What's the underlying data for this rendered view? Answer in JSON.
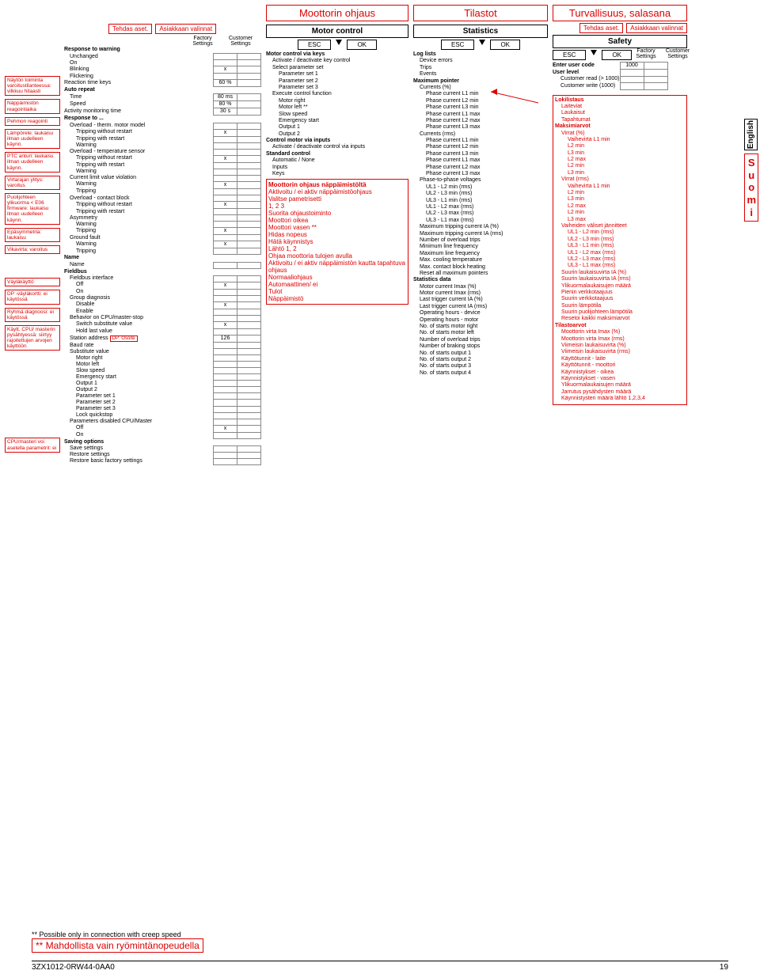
{
  "sidebar_callouts": [
    "Näytön toiminta varoitustilanteessa: vilkkuu hitaasti",
    "Näppäimistön reagointiaika",
    "Pehmon reagointi",
    "Lämpörele: laukaisu ilman uudelleen käynn.",
    "PTC anturi: laukaisu ilman uudelleen käynn.",
    "Virtarajan ylitys: varoitus",
    "Puolijohteen ylikuorma < E06 firmware: laukaisu ilman uudelleen käynn.",
    "Epäsymmetria: laukaisu",
    "Vikavirta: varoitus",
    "Väyläkäyttö",
    "DP -väyläkortti: ei käytössä",
    "Ryhmä diagnoosi: ei käytössä",
    "Käytt. CPU/ masterin pysähtyessä: siirtyy rajoitettujen arvojen käyttöön",
    "CPU/masteri voi asetella parametrit: ei"
  ],
  "settings": {
    "tag_factory": "Tehdas aset.",
    "tag_customer": "Asiakkaan valinnat",
    "col1": "Factory Settings",
    "col2": "Customer Settings",
    "rows": [
      [
        "Response to warning",
        "",
        "",
        0,
        true
      ],
      [
        "Unchanged",
        "",
        "",
        1,
        false
      ],
      [
        "On",
        "",
        "",
        1,
        false
      ],
      [
        "Blinking",
        "x",
        "",
        1,
        false
      ],
      [
        "Flickering",
        "",
        "",
        1,
        false
      ],
      [
        "Reaction time keys",
        "60 %",
        "",
        0,
        false
      ],
      [
        "Auto repeat",
        "",
        "",
        0,
        true
      ],
      [
        "Time",
        "80 ms",
        "",
        1,
        false
      ],
      [
        "Speed",
        "80 %",
        "",
        1,
        false
      ],
      [
        "Activity monitoring time",
        "30 s",
        "",
        0,
        false
      ],
      [
        "Response to ...",
        "",
        "",
        0,
        true
      ],
      [
        "Overload - therm. motor model",
        "",
        "",
        1,
        false
      ],
      [
        "Tripping without restart",
        "x",
        "",
        2,
        false
      ],
      [
        "Tripping with restart",
        "",
        "",
        2,
        false
      ],
      [
        "Warning",
        "",
        "",
        2,
        false
      ],
      [
        "Overload - temperature sensor",
        "",
        "",
        1,
        false
      ],
      [
        "Tripping without restart",
        "x",
        "",
        2,
        false
      ],
      [
        "Tripping with restart",
        "",
        "",
        2,
        false
      ],
      [
        "Warning",
        "",
        "",
        2,
        false
      ],
      [
        "Current limit value violation",
        "",
        "",
        1,
        false
      ],
      [
        "Warning",
        "x",
        "",
        2,
        false
      ],
      [
        "Tripping",
        "",
        "",
        2,
        false
      ],
      [
        "Overload - contact block",
        "",
        "",
        1,
        false
      ],
      [
        "Tripping without restart",
        "x",
        "",
        2,
        false
      ],
      [
        "Tripping with restart",
        "",
        "",
        2,
        false
      ],
      [
        "Asymmetry",
        "",
        "",
        1,
        false
      ],
      [
        "Warning",
        "",
        "",
        2,
        false
      ],
      [
        "Tripping",
        "x",
        "",
        2,
        false
      ],
      [
        "Ground fault",
        "",
        "",
        1,
        false
      ],
      [
        "Warning",
        "x",
        "",
        2,
        false
      ],
      [
        "Tripping",
        "",
        "",
        2,
        false
      ],
      [
        "Name",
        "",
        "",
        0,
        true
      ],
      [
        "Name",
        "",
        "",
        1,
        false
      ],
      [
        "Fieldbus",
        "",
        "",
        0,
        true
      ],
      [
        "Fieldbus interface",
        "",
        "",
        1,
        false
      ],
      [
        "Off",
        "x",
        "",
        2,
        false
      ],
      [
        "On",
        "",
        "",
        2,
        false
      ],
      [
        "Group diagnosis",
        "",
        "",
        1,
        false
      ],
      [
        "Disable",
        "x",
        "",
        2,
        false
      ],
      [
        "Enable",
        "",
        "",
        2,
        false
      ],
      [
        "Behavior on CPU/master-stop",
        "",
        "",
        1,
        false
      ],
      [
        "Switch substitute value",
        "x",
        "",
        2,
        false
      ],
      [
        "Hold last value",
        "",
        "",
        2,
        false
      ],
      [
        "Station address",
        "126",
        "",
        1,
        false,
        "DP: Osoite"
      ],
      [
        "Baud rate",
        "",
        "",
        1,
        false
      ],
      [
        "Substitute value",
        "",
        "",
        1,
        false
      ],
      [
        "Motor right",
        "",
        "",
        2,
        false
      ],
      [
        "Motor left",
        "",
        "",
        2,
        false
      ],
      [
        "Slow speed",
        "",
        "",
        2,
        false
      ],
      [
        "Emergency start",
        "",
        "",
        2,
        false
      ],
      [
        "Output 1",
        "",
        "",
        2,
        false
      ],
      [
        "Output 2",
        "",
        "",
        2,
        false
      ],
      [
        "Parameter set 1",
        "",
        "",
        2,
        false
      ],
      [
        "Parameter set 2",
        "",
        "",
        2,
        false
      ],
      [
        "Parameter set 3",
        "",
        "",
        2,
        false
      ],
      [
        "Lock quickstop",
        "",
        "",
        2,
        false
      ],
      [
        "Parameters disabled CPU/Master",
        "",
        "",
        1,
        false
      ],
      [
        "Off",
        "x",
        "",
        2,
        false
      ],
      [
        "On",
        "",
        "",
        2,
        false
      ],
      [
        "Saving options",
        "",
        "",
        0,
        true
      ],
      [
        "Save settings",
        "",
        "",
        1,
        false
      ],
      [
        "Restore settings",
        "",
        "",
        1,
        false
      ],
      [
        "Restore basic factory settings",
        "",
        "",
        1,
        false
      ]
    ]
  },
  "motor": {
    "title_fi": "Moottorin ohjaus",
    "title_en": "Motor control",
    "btn_esc": "ESC",
    "btn_ok": "OK",
    "list": [
      [
        "Motor control via keys",
        0,
        true
      ],
      [
        "Activate / deactivate key control",
        1,
        false
      ],
      [
        "Select parameter set",
        1,
        false
      ],
      [
        "Parameter set 1",
        2,
        false
      ],
      [
        "Parameter set 2",
        2,
        false
      ],
      [
        "Parameter set 3",
        2,
        false
      ],
      [
        "Execute control function",
        1,
        false
      ],
      [
        "Motor right",
        2,
        false
      ],
      [
        "Motor left **",
        2,
        false
      ],
      [
        "Slow speed",
        2,
        false
      ],
      [
        "Emergency start",
        2,
        false
      ],
      [
        "Output 1",
        2,
        false
      ],
      [
        "Output 2",
        2,
        false
      ],
      [
        "Control motor via inputs",
        0,
        true
      ],
      [
        "Activate / deactivate control via inputs",
        1,
        false
      ],
      [
        "Standard control",
        0,
        true
      ],
      [
        "Automatic / None",
        1,
        false
      ],
      [
        "Inputs",
        1,
        false
      ],
      [
        "Keys",
        1,
        false
      ]
    ],
    "red_list": [
      [
        "Moottorin ohjaus näppäimistöltä",
        0,
        true
      ],
      [
        "Aktivoitu / ei aktiv näppäimistöohjaus",
        0,
        false
      ],
      [
        "Valitse pametrisetti",
        0,
        false
      ],
      [
        "1, 2 3",
        1,
        false
      ],
      [
        "Suorita ohjaustoiminto",
        0,
        false
      ],
      [
        "Moottori oikea",
        1,
        false
      ],
      [
        "Moottori vasen **",
        1,
        false
      ],
      [
        "Hidas nopeus",
        1,
        false
      ],
      [
        "Hätä käynnistys",
        1,
        false
      ],
      [
        "Lähtö 1, 2",
        1,
        false
      ],
      [
        "Ohjaa moottoria tulojen avulla",
        0,
        false
      ],
      [
        "Aktivoitu / ei aktiv näppäimistön kautta tapahtuva ohjaus",
        1,
        false
      ],
      [
        "Normaaliohjaus",
        0,
        false
      ],
      [
        "Automaattinen/ ei",
        1,
        false
      ],
      [
        "Tulot",
        1,
        false
      ],
      [
        "Näppäimistö",
        1,
        false
      ]
    ]
  },
  "stats": {
    "title_fi": "Tilastot",
    "title_en": "Statistics",
    "btn_esc": "ESC",
    "btn_ok": "OK",
    "list": [
      [
        "Log lists",
        0,
        true
      ],
      [
        "Device errors",
        1,
        false
      ],
      [
        "Trips",
        1,
        false
      ],
      [
        "Events",
        1,
        false
      ],
      [
        "Maximum pointer",
        0,
        true
      ],
      [
        "Currents (%)",
        1,
        false
      ],
      [
        "Phase current L1 min",
        2,
        false
      ],
      [
        "Phase current L2 min",
        2,
        false
      ],
      [
        "Phase current L3 min",
        2,
        false
      ],
      [
        "Phase current L1 max",
        2,
        false
      ],
      [
        "Phase current L2 max",
        2,
        false
      ],
      [
        "Phase current L3 max",
        2,
        false
      ],
      [
        "Currents (rms)",
        1,
        false
      ],
      [
        "Phase current L1 min",
        2,
        false
      ],
      [
        "Phase current L2 min",
        2,
        false
      ],
      [
        "Phase current L3 min",
        2,
        false
      ],
      [
        "Phase current L1 max",
        2,
        false
      ],
      [
        "Phase current L2 max",
        2,
        false
      ],
      [
        "Phase current L3 max",
        2,
        false
      ],
      [
        "Phase-to-phase voltages",
        1,
        false
      ],
      [
        "UL1 - L2 min (rms)",
        2,
        false
      ],
      [
        "UL2 - L3 min (rms)",
        2,
        false
      ],
      [
        "UL3 - L1 min (rms)",
        2,
        false
      ],
      [
        "UL1 - L2 max (rms)",
        2,
        false
      ],
      [
        "UL2 - L3 max (rms)",
        2,
        false
      ],
      [
        "UL3 - L1 max (rms)",
        2,
        false
      ],
      [
        "Maximum tripping current IA (%)",
        1,
        false
      ],
      [
        "Maximum tripping current IA (rms)",
        1,
        false
      ],
      [
        "Number of overload trips",
        1,
        false
      ],
      [
        "Minimum line frequency",
        1,
        false
      ],
      [
        "Maximum line frequency",
        1,
        false
      ],
      [
        "Max. cooling temperature",
        1,
        false
      ],
      [
        "Max. contact block heating",
        1,
        false
      ],
      [
        "Reset all maximum pointers",
        1,
        false
      ],
      [
        "Statistics data",
        0,
        true
      ],
      [
        "Motor current Imax (%)",
        1,
        false
      ],
      [
        "Motor current Imax (rms)",
        1,
        false
      ],
      [
        "Last trigger current IA (%)",
        1,
        false
      ],
      [
        "Last trigger current IA (rms)",
        1,
        false
      ],
      [
        "Operating hours - device",
        1,
        false
      ],
      [
        "Operating hours - motor",
        1,
        false
      ],
      [
        "No. of starts motor right",
        1,
        false
      ],
      [
        "No. of starts motor left",
        1,
        false
      ],
      [
        "Number of overload trips",
        1,
        false
      ],
      [
        "Number of braking stops",
        1,
        false
      ],
      [
        "No. of starts output 1",
        1,
        false
      ],
      [
        "No. of starts output 2",
        1,
        false
      ],
      [
        "No. of starts output 3",
        1,
        false
      ],
      [
        "No. of starts output 4",
        1,
        false
      ]
    ]
  },
  "safety": {
    "title_fi": "Turvallisuus, salasana",
    "title_en": "Safety",
    "tag_factory": "Tehdas aset.",
    "tag_customer": "Asiakkaan valinnat",
    "col1": "Factory Settings",
    "col2": "Customer Settings",
    "btn_esc": "ESC",
    "btn_ok": "OK",
    "table": [
      [
        "Enter user code",
        "1000",
        ""
      ],
      [
        "User level",
        "",
        ""
      ],
      [
        "Customer read (> 1000)",
        "",
        ""
      ],
      [
        "Customer write (1000)",
        "",
        ""
      ]
    ],
    "red_list": [
      [
        "Lokilistaus",
        0,
        true
      ],
      [
        "Laiteviat",
        1,
        false
      ],
      [
        "Laukaisut",
        1,
        false
      ],
      [
        "Tapahtumat",
        1,
        false
      ],
      [
        "Maksimiarvot",
        0,
        true
      ],
      [
        "Virrat (%)",
        1,
        false
      ],
      [
        "Vaihevirta L1 min",
        2,
        false
      ],
      [
        "L2 min",
        2,
        false
      ],
      [
        "L3 min",
        2,
        false
      ],
      [
        "L2 max",
        2,
        false
      ],
      [
        "L2 min",
        2,
        false
      ],
      [
        "L3 min",
        2,
        false
      ],
      [
        "Virrat (rms)",
        1,
        false
      ],
      [
        "Vaihevirta L1 min",
        2,
        false
      ],
      [
        "L2 min",
        2,
        false
      ],
      [
        "L3 min",
        2,
        false
      ],
      [
        "L2 max",
        2,
        false
      ],
      [
        "L2 min",
        2,
        false
      ],
      [
        "L3 max",
        2,
        false
      ],
      [
        "Vaiheiden väliset jännitteet",
        1,
        false
      ],
      [
        "UL1 - L2 min (rms)",
        2,
        false
      ],
      [
        "UL2 - L3 min (rms)",
        2,
        false
      ],
      [
        "UL3 - L1 min (rms)",
        2,
        false
      ],
      [
        "UL1 - L2 max (rms)",
        2,
        false
      ],
      [
        "UL2 - L3 max (rms)",
        2,
        false
      ],
      [
        "UL3 - L1 max (rms)",
        2,
        false
      ],
      [
        "Suurin laukaisuvirta IA (%)",
        1,
        false
      ],
      [
        "Suurin laukaisuvirta IA (rms)",
        1,
        false
      ],
      [
        "Ylikuormalaukaisujen määrä",
        1,
        false
      ],
      [
        "Pienin verkkotaajuus",
        1,
        false
      ],
      [
        "Suurin verkkotaajuus",
        1,
        false
      ],
      [
        "Suurin lämpötila",
        1,
        false
      ],
      [
        "Suurin puolijohteen lämpötila",
        1,
        false
      ],
      [
        "Resetoi kaikki maksimiarvot",
        1,
        false
      ],
      [
        "Tilastoarvot",
        0,
        true
      ],
      [
        "Moottorin virta Imax (%)",
        1,
        false
      ],
      [
        "Moottorin virta Imax (rms)",
        1,
        false
      ],
      [
        "Viimeisin laukaisuvirta (%)",
        1,
        false
      ],
      [
        "Viimeisin laukaisuvirta (rms)",
        1,
        false
      ],
      [
        "Käyttötunnit - laite",
        1,
        false
      ],
      [
        "Käyttötunnit - moottori",
        1,
        false
      ],
      [
        "Käynnistykset - oikea",
        1,
        false
      ],
      [
        "Käynnistykset - vasen",
        1,
        false
      ],
      [
        "Ylikuormalaukaisujen määrä",
        1,
        false
      ],
      [
        "Jarrutus pysähdysten määrä",
        1,
        false
      ],
      [
        "Käynnistysten määrä lähtö 1,2,3,4",
        1,
        false
      ]
    ]
  },
  "lang": {
    "en": "English",
    "fi": "S\nu\no\nm\ni"
  },
  "footer": {
    "note_en": "** Possible only in connection with creep speed",
    "note_fi": "** Mahdollista vain ryömintänopeudella",
    "docnum": "3ZX1012-0RW44-0AA0",
    "page": "19"
  }
}
